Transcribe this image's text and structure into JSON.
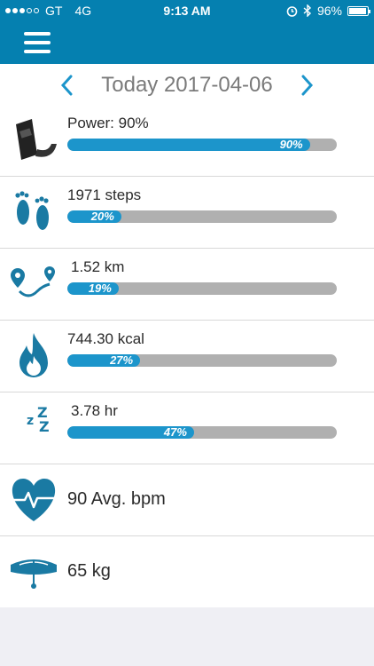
{
  "status_bar": {
    "carrier": "GT",
    "network": "4G",
    "time": "9:13 AM",
    "battery": "96%",
    "battery_level": 0.96,
    "signal_bars": 3
  },
  "header": {
    "menu_icon": "hamburger-icon"
  },
  "date_nav": {
    "label": "Today 2017-04-06",
    "prev_icon": "chevron-left-icon",
    "next_icon": "chevron-right-icon"
  },
  "metrics": [
    {
      "icon": "fitness-band-icon",
      "label": "Power: 90%",
      "percent": 90,
      "percent_label": "90%"
    },
    {
      "icon": "footprints-icon",
      "label": "1971 steps",
      "percent": 20,
      "percent_label": "20%"
    },
    {
      "icon": "route-pins-icon",
      "label": "1.52 km",
      "percent": 19,
      "percent_label": "19%"
    },
    {
      "icon": "flame-icon",
      "label": "744.30 kcal",
      "percent": 27,
      "percent_label": "27%"
    },
    {
      "icon": "sleep-moon-icon",
      "label": "3.78 hr",
      "percent": 47,
      "percent_label": "47%"
    },
    {
      "icon": "heart-rate-icon",
      "label": "90 Avg. bpm"
    },
    {
      "icon": "scale-icon",
      "label": "65 kg"
    }
  ],
  "colors": {
    "header": "#0580b0",
    "accent": "#1c95cb",
    "icon": "#1a7aa3",
    "bar_track": "#b0b0b0"
  }
}
